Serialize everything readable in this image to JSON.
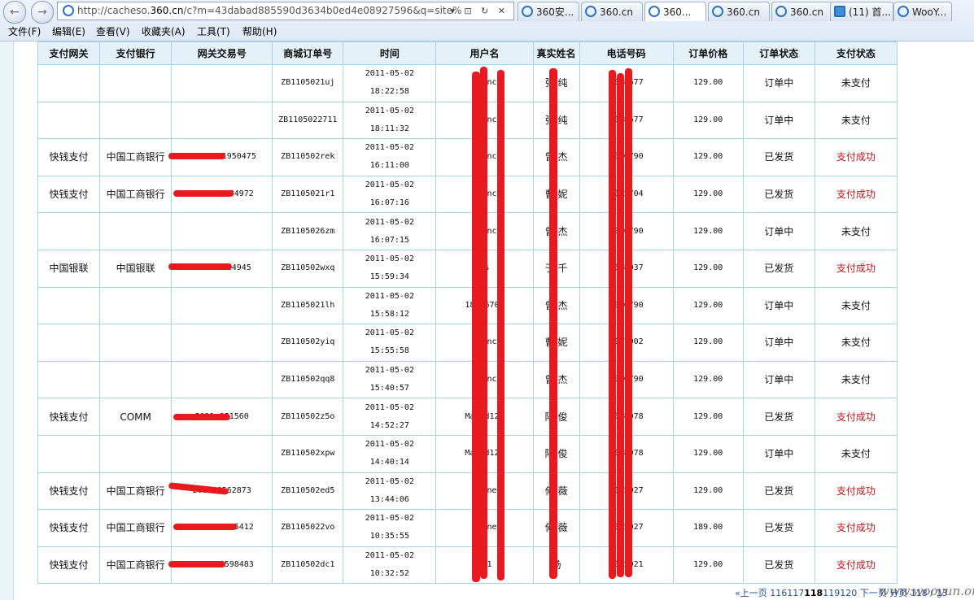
{
  "browser": {
    "address": "http://cacheso.360.cn/c?m=43dabad885590d3634b0ed4e08927596&q=site%",
    "address_host_prefix": "http://cacheso.",
    "address_host": "360.cn",
    "address_rest": "/c?m=43dabad885590d3634b0ed4e08927596&q=site%",
    "address_tools": "▾ ⊡ ↻ ✕",
    "tabs": [
      "360安...",
      "360.cn",
      "360...",
      "360.cn",
      "360.cn",
      "(11) 首...",
      "WooY..."
    ]
  },
  "menu": [
    "文件(F)",
    "编辑(E)",
    "查看(V)",
    "收藏夹(A)",
    "工具(T)",
    "帮助(H)"
  ],
  "table": {
    "headers": [
      "支付网关",
      "支付银行",
      "网关交易号",
      "商城订单号",
      "时间",
      "用户名",
      "真实姓名",
      "电话号码",
      "订单价格",
      "订单状态",
      "支付状态"
    ],
    "rows": [
      [
        "",
        "",
        "",
        "ZB1105021uj",
        "2011-05-02 18:22:58",
        "zh    nc",
        "张  纯",
        "13   8677",
        "129.00",
        "订单中",
        "未支付"
      ],
      [
        "",
        "",
        "",
        "ZB1105022711",
        "2011-05-02 18:11:32",
        "zh    nc",
        "张  纯",
        "13   8677",
        "129.00",
        "订单中",
        "未支付"
      ],
      [
        "快钱支付",
        "中国工商银行",
        "2011   231950475",
        "ZB110502rek",
        "2011-05-02 16:11:00",
        "zh    nc",
        "曾  杰",
        "18   6790",
        "129.00",
        "已发货",
        "支付成功"
      ],
      [
        "快钱支付",
        "中国工商银行",
        "2011   40984972",
        "ZB1105021r1",
        "2011-05-02 16:07:16",
        "zh    nc",
        "曹  妮",
        "13   5704",
        "129.00",
        "已发货",
        "支付成功"
      ],
      [
        "",
        "",
        "",
        "ZB1105026zm",
        "2011-05-02 16:07:15",
        "zh    nc",
        "曾  杰",
        "18   6790",
        "129.00",
        "订单中",
        "未支付"
      ],
      [
        "中国银联",
        "中国银联",
        "2011   0464945",
        "ZB110502wxq",
        "2011-05-02 15:59:34",
        "   ss",
        "于  千",
        "15   8037",
        "129.00",
        "已发货",
        "支付成功"
      ],
      [
        "",
        "",
        "",
        "ZB1105021lh",
        "2011-05-02 15:58:12",
        "187   6700",
        "曾  杰",
        "18   6790",
        "129.00",
        "订单中",
        "未支付"
      ],
      [
        "",
        "",
        "",
        "ZB110502yiq",
        "2011-05-02 15:55:58",
        "zh    nc",
        "曹  妮",
        "13   7902",
        "129.00",
        "订单中",
        "未支付"
      ],
      [
        "",
        "",
        "",
        "ZB110502qq8",
        "2011-05-02 15:40:57",
        "zh    nc",
        "曾  杰",
        "18   6790",
        "129.00",
        "订单中",
        "未支付"
      ],
      [
        "快钱支付",
        "COMM",
        "2011   851560",
        "ZB110502z5o",
        "2011-05-02 14:52:27",
        "Mag   d123",
        "陆  俊",
        "13   8978",
        "129.00",
        "已发货",
        "支付成功"
      ],
      [
        "",
        "",
        "",
        "ZB110502xpw",
        "2011-05-02 14:40:14",
        "Mag   d123",
        "陆  俊",
        "13   8978",
        "129.00",
        "订单中",
        "未支付"
      ],
      [
        "快钱支付",
        "中国工商银行",
        "2011   8562873",
        "ZB110502ed5",
        "2011-05-02 13:44:06",
        "zh    ne",
        "何  薇",
        "13   5027",
        "129.00",
        "已发货",
        "支付成功"
      ],
      [
        "快钱支付",
        "中国工商银行",
        "2011   41275412",
        "ZB1105022vo",
        "2011-05-02 10:35:55",
        "zh    ne",
        "何  薇",
        "13   5027",
        "189.00",
        "已发货",
        "支付成功"
      ],
      [
        "快钱支付",
        "中国工商银行",
        "2011   19598483",
        "ZB110502dc1",
        "2011-05-02 10:32:52",
        "8   1",
        "杨",
        "13   5921",
        "129.00",
        "已发货",
        "支付成功"
      ]
    ]
  },
  "pager": {
    "prev": "«上一页",
    "pages_before": "116117",
    "current": "118",
    "pages_after": "119120",
    "next": "下一页",
    "tail": "分页 118 / 13"
  },
  "watermark": "www.wooyun.org",
  "colors": {
    "success": "#c4151a",
    "header_bg": "#e4f1f8",
    "border": "#a9d3e3",
    "redaction": "#e8191f"
  }
}
